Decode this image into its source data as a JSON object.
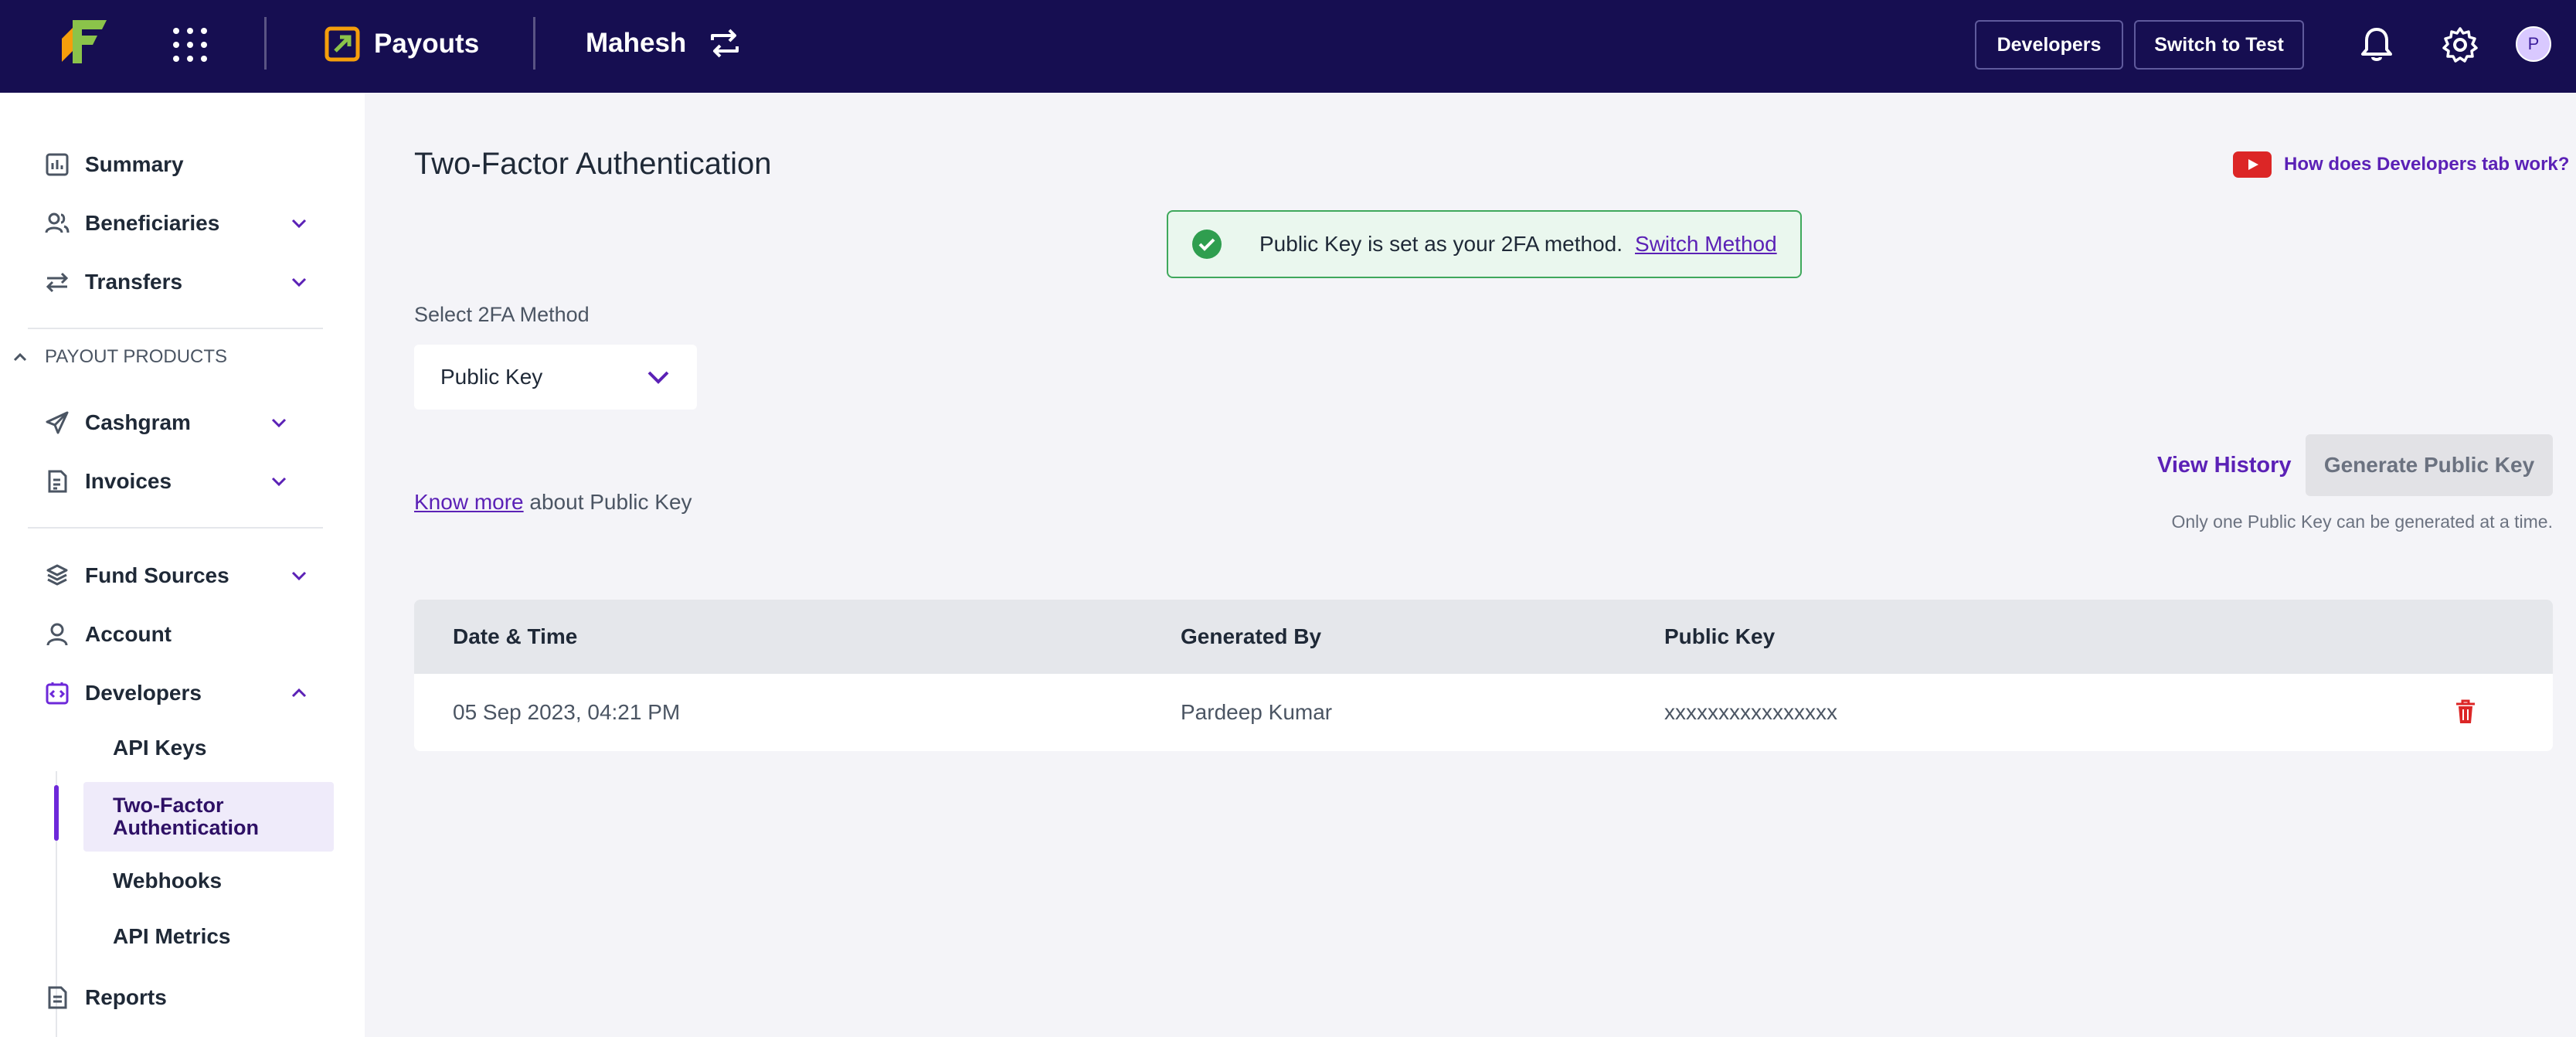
{
  "topbar": {
    "product": "Payouts",
    "merchant": "Mahesh",
    "developers_button": "Developers",
    "switch_button": "Switch to Test",
    "avatar_initial": "P"
  },
  "sidebar": {
    "summary": "Summary",
    "beneficiaries": "Beneficiaries",
    "transfers": "Transfers",
    "section_payout_products": "PAYOUT PRODUCTS",
    "cashgram": "Cashgram",
    "invoices": "Invoices",
    "fund_sources": "Fund Sources",
    "account": "Account",
    "developers": "Developers",
    "developers_sub": {
      "api_keys": "API Keys",
      "two_factor": "Two-Factor Authentication",
      "webhooks": "Webhooks",
      "api_metrics": "API Metrics"
    },
    "reports": "Reports"
  },
  "main": {
    "title": "Two-Factor Authentication",
    "help_link": "How does Developers tab work?",
    "banner": {
      "text": "Public Key is set as your 2FA method.",
      "link": "Switch Method"
    },
    "select_label": "Select 2FA Method",
    "select_value": "Public Key",
    "know_more_link": "Know more",
    "know_more_rest": " about Public Key",
    "view_history": "View History",
    "generate_button": "Generate Public Key",
    "generate_note": "Only one Public Key can be generated at a time.",
    "table": {
      "headers": [
        "Date & Time",
        "Generated By",
        "Public Key"
      ],
      "rows": [
        [
          "05 Sep 2023, 04:21 PM",
          "Pardeep Kumar",
          "xxxxxxxxxxxxxxxx"
        ]
      ]
    }
  },
  "colors": {
    "topbar_bg": "#160e51",
    "accent_purple": "#5b21b6",
    "success_green": "#3fa85c",
    "delete_red": "#dc2626"
  }
}
